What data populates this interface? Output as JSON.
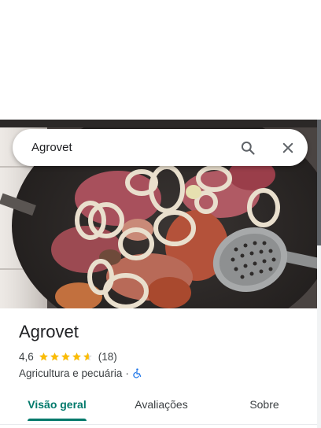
{
  "search": {
    "query": "Agrovet"
  },
  "place": {
    "name": "Agrovet",
    "rating": "4,6",
    "rating_stars": 4.6,
    "review_count": "(18)",
    "category": "Agricultura e pecuária",
    "separator": "·",
    "accessibility_icon": "wheelchair-icon"
  },
  "tabs": [
    {
      "label": "Visão geral",
      "active": true
    },
    {
      "label": "Avaliações",
      "active": false
    },
    {
      "label": "Sobre",
      "active": false
    }
  ],
  "colors": {
    "accent": "#00796b",
    "star": "#fbbc04",
    "accessibility": "#1a73e8"
  }
}
